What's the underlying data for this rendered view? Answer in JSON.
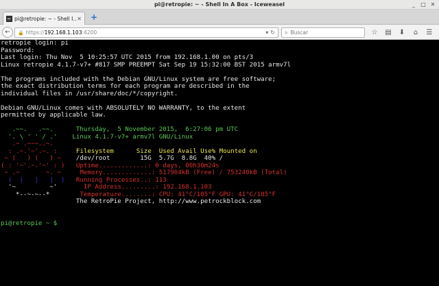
{
  "window": {
    "title": "pi@retropie: ~ - Shell In A Box - Iceweasel",
    "controls": [
      "_",
      "□",
      "✕"
    ]
  },
  "tab": {
    "title": "pi@retropie: ~ - Shell I...",
    "close": "✕",
    "new_tab": "+"
  },
  "navbar": {
    "back": "←",
    "lock": "🔒",
    "url_proto": "https://",
    "url_host": "192.168.1.103",
    "url_port": ":4200",
    "url_icons": [
      "▾",
      "↻"
    ],
    "search_icon": "⌕",
    "search_placeholder": "Buscar",
    "tool_icons": {
      "bookmark": "☆",
      "reader": "▤",
      "download": "⬇",
      "home": "⌂",
      "menu": "☰"
    }
  },
  "terminal": {
    "login_lines": [
      "retropie login: pi",
      "Password:",
      "Last login: Thu Nov  5 10:25:57 UTC 2015 from 192.168.1.00 on pts/3",
      "Linux retropie 4.1.7-v7+ #817 SMP PREEMPT Sat Sep 19 15:32:00 BST 2015 armv7l",
      "",
      "The programs included with the Debian GNU/Linux system are free software;",
      "the exact distribution terms for each program are described in the",
      "individual files in /usr/share/doc/*/copyright.",
      "",
      "Debian GNU/Linux comes with ABSOLUTELY NO WARRANTY, to the extent",
      "permitted by applicable law.",
      ""
    ],
    "motd": {
      "logo": [
        "   .~~.   .~~.  ",
        "  '. \\ ' ' / .' ",
        "   .~ .~~~..~.  ",
        "  : .~.'~'.~. : ",
        " ~ (   ) (   ) ~",
        "( : '~'.~.'~' : )",
        " ~ .~       ~. ~",
        "  (  |   |   |  )",
        "  '~         ~' ",
        "    *--~-~--*   "
      ],
      "date": "Thursday,  5 November 2015,  6:27:06 pm UTC",
      "kernel": "Linux 4.1.7-v7+ armv7l GNU/Linux",
      "fs_header": "Filesystem      Size  Used Avail Use% Mounted on",
      "fs_row": "/dev/root        15G  5.7G  8.8G  40% /",
      "uptime_label": "Uptime.............: ",
      "uptime_value": "0 days, 00h30m24s",
      "memory_label": "Memory.............: ",
      "memory_value": "517904kB (Free) / 753240kB (Total)",
      "processes_label": "Running Processes..: ",
      "processes_value": "113",
      "ip_label": "IP Address.........: ",
      "ip_value": "192.168.1.103",
      "temp_label": "Temperature........: ",
      "temp_value": "CPU: 41°C/105°F GPU: 41°C/105°F",
      "project": "The RetroPie Project, http://www.petrockblock.com"
    },
    "prompt": {
      "user_host": "pi@retropie",
      "path": " ~ ",
      "symbol": "$"
    }
  },
  "colors": {
    "terminal_bg": "#000000",
    "terminal_fg": "#e8e8e8",
    "green": "#58c858",
    "red": "#d83030",
    "yellow": "#e8e850",
    "blue": "#3838d8"
  }
}
